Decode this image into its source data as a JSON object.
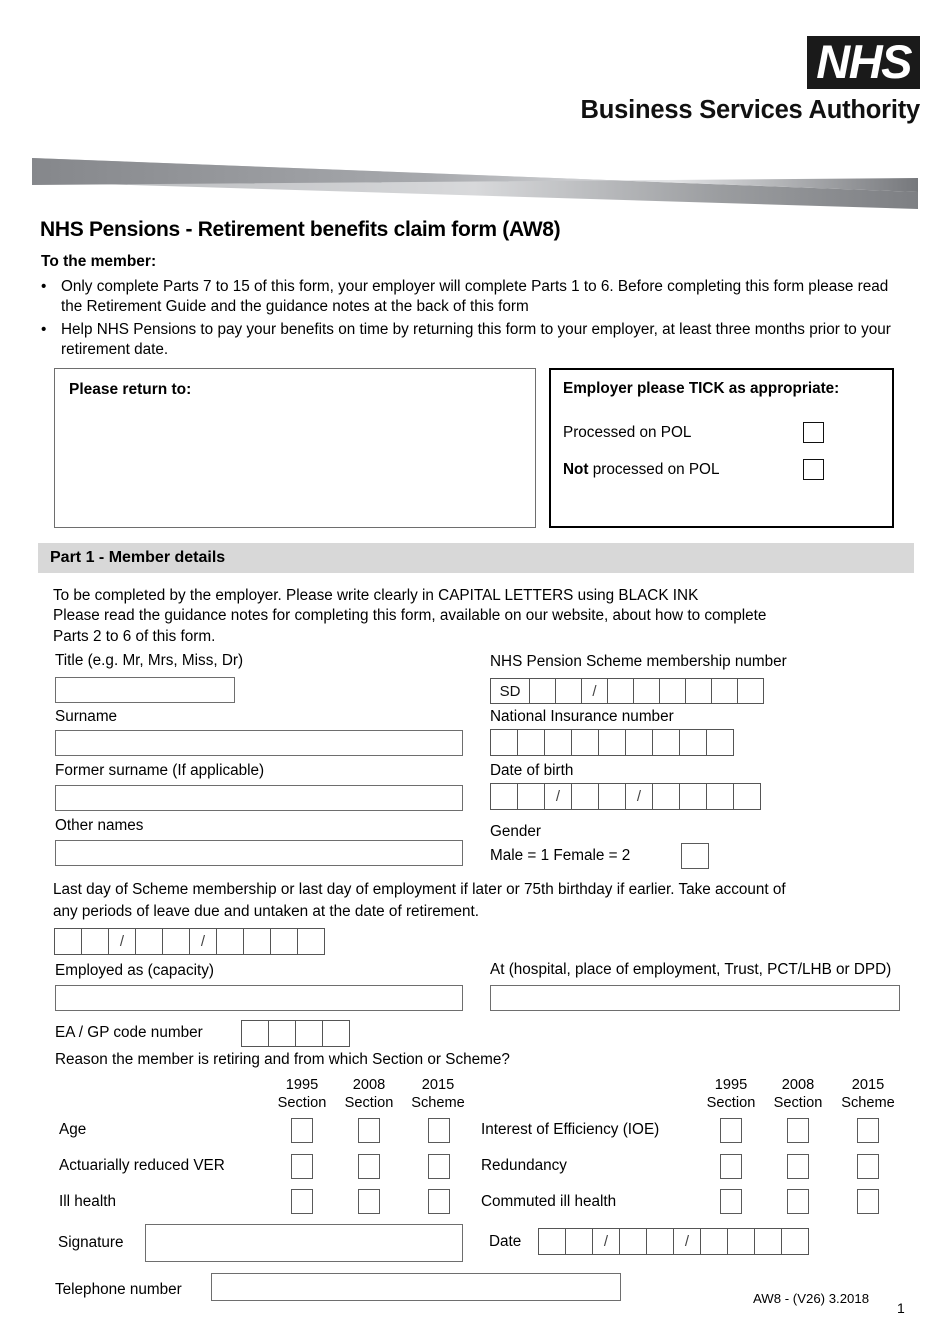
{
  "header": {
    "logo_text": "NHS",
    "org_name": "Business Services Authority"
  },
  "title": "NHS Pensions - Retirement benefits claim form (AW8)",
  "intro": {
    "heading": "To the member:",
    "bullet_marker": "•",
    "bullets": [
      "Only complete Parts 7 to 15 of this form, your employer will complete Parts 1 to 6. Before completing this form please read the Retirement Guide and the guidance notes at the back of this form",
      "Help NHS Pensions to pay your benefits on time by returning this form to your employer, at least three months prior to your retirement date."
    ]
  },
  "return_box": {
    "label": "Please return to:"
  },
  "tick_box": {
    "title": "Employer please TICK as appropriate:",
    "rows": [
      {
        "bold": "",
        "text": "Processed on POL"
      },
      {
        "bold": "Not",
        "text": " processed on POL"
      }
    ]
  },
  "part1": {
    "band_title": "Part 1 - Member details",
    "intro_lines": [
      "To be completed by the employer.  Please write clearly in CAPITAL LETTERS using BLACK INK",
      "Please read the guidance notes for completing this form, available on our website, about how to complete",
      "Parts 2 to 6 of this form."
    ],
    "left_fields": [
      {
        "label": "Title   (e.g. Mr, Mrs, Miss, Dr)",
        "value": ""
      },
      {
        "label": "Surname",
        "value": ""
      },
      {
        "label": "Former surname (If applicable)",
        "value": ""
      },
      {
        "label": "Other names",
        "value": ""
      }
    ],
    "membership": {
      "label": "NHS Pension Scheme membership number",
      "cells": [
        "SD",
        "",
        "",
        "/",
        "",
        "",
        "",
        "",
        "",
        ""
      ]
    },
    "ni_number": {
      "label": "National Insurance number",
      "cells": [
        "",
        "",
        "",
        "",
        "",
        "",
        "",
        "",
        ""
      ]
    },
    "dob": {
      "label": "Date of birth",
      "cells": [
        "",
        "",
        "/",
        "",
        "",
        "/",
        "",
        "",
        "",
        ""
      ]
    },
    "gender": {
      "label": "Gender",
      "options_text": "Male = 1  Female = 2",
      "value": ""
    },
    "last_day": {
      "text_lines": [
        "Last day of Scheme membership or last day of employment if later or 75th birthday if earlier.  Take account of",
        "any periods of leave due and untaken at the date of retirement."
      ],
      "cells": [
        "",
        "",
        "/",
        "",
        "",
        "/",
        "",
        "",
        "",
        ""
      ]
    },
    "employed_as": {
      "label": "Employed as (capacity)",
      "value": ""
    },
    "at_place": {
      "label": "At (hospital, place of employment, Trust, PCT/LHB or DPD)",
      "value": ""
    },
    "ea_gp": {
      "label": "EA / GP code number",
      "cells": [
        "",
        "",
        "",
        ""
      ]
    },
    "reason": {
      "question": "Reason the member is retiring and from which Section or Scheme?",
      "columns": [
        {
          "line1": "1995",
          "line2": "Section"
        },
        {
          "line1": "2008",
          "line2": "Section"
        },
        {
          "line1": "2015",
          "line2": "Scheme"
        }
      ],
      "left_rows": [
        "Age",
        "Actuarially reduced VER",
        "Ill health"
      ],
      "right_rows": [
        "Interest of Efficiency (IOE)",
        "Redundancy",
        "Commuted ill health"
      ]
    },
    "signature": {
      "label": "Signature",
      "value": ""
    },
    "date": {
      "label": "Date",
      "cells": [
        "",
        "",
        "/",
        "",
        "",
        "/",
        "",
        "",
        "",
        ""
      ]
    },
    "telephone": {
      "label": "Telephone number",
      "value": ""
    }
  },
  "footer": {
    "code": "AW8 - (V26)  3.2018",
    "page_number": "1"
  },
  "colors": {
    "band_grey": "#d8d8d8",
    "banner_dark": "#7f8084",
    "banner_light": "#b8babd",
    "border": "#6e6e6e"
  }
}
